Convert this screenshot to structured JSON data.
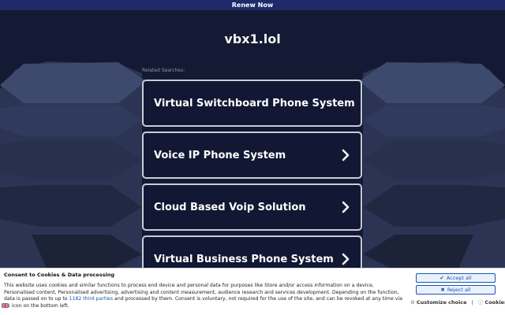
{
  "topbar": {
    "label": "Renew Now"
  },
  "header": {
    "domain": "vbx1.lol"
  },
  "main": {
    "related_label": "Related Searches:",
    "links": [
      {
        "label": "Virtual Switchboard Phone System"
      },
      {
        "label": "Voice IP Phone System"
      },
      {
        "label": "Cloud Based Voip Solution"
      },
      {
        "label": "Virtual Business Phone System"
      }
    ]
  },
  "cookie": {
    "title": "Consent to Cookies & Data processing",
    "text_before": "This website uses cookies and similar functions to process end device and personal data for purposes like Store and/or access information on a device, Personalised content, Personalised advertising, advertising and content measurement, audience research and services development. Depending on the function, data is passed on to up to ",
    "third_parties_link": "1182 third parties",
    "text_after": " and processed by them. Consent is voluntary, not required for the use of the site, and can be revoked at any time via an icon on the bottom left.",
    "accept_label": "Accept all",
    "reject_label": "Reject all",
    "customize_label": "Customize choice",
    "separator": "|",
    "cookies_label": "Cookies"
  },
  "colors": {
    "page_bg": "#141a33",
    "topbar_bg": "#1f2a6b",
    "link_border": "#c7ccd6",
    "accent_blue": "#1b55b0"
  }
}
